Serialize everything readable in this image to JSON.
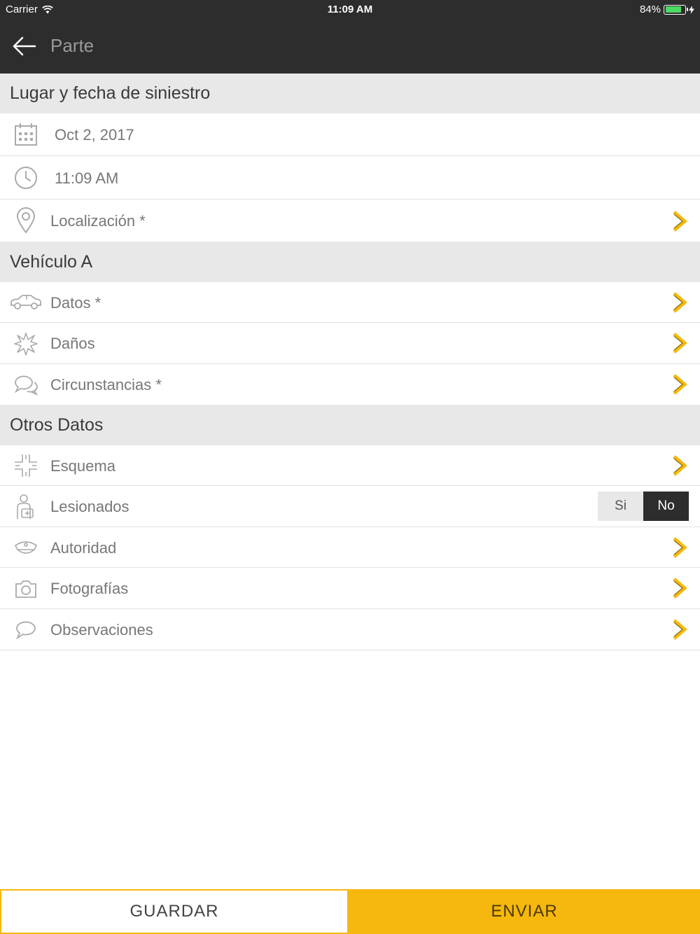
{
  "status_bar": {
    "carrier": "Carrier",
    "time": "11:09 AM",
    "battery": "84%",
    "battery_level": 0.84
  },
  "nav": {
    "title": "Parte"
  },
  "sections": {
    "lugar": "Lugar y fecha de siniestro",
    "vehiculo": "Vehículo A",
    "otros": "Otros Datos"
  },
  "rows": {
    "fecha": "Oct 2, 2017",
    "hora": "11:09 AM",
    "localizacion": "Localización *",
    "datos": "Datos *",
    "danos": "Daños",
    "circunstancias": "Circunstancias *",
    "esquema": "Esquema",
    "lesionados": "Lesionados",
    "autoridad": "Autoridad",
    "fotografias": "Fotografías",
    "observaciones": "Observaciones"
  },
  "toggle": {
    "si": "Si",
    "no": "No",
    "selected": "No"
  },
  "buttons": {
    "guardar": "GUARDAR",
    "enviar": "ENVIAR"
  },
  "colors": {
    "accent": "#f6b80e",
    "bar": "#2d2d2d",
    "section": "#e8e8e8"
  }
}
